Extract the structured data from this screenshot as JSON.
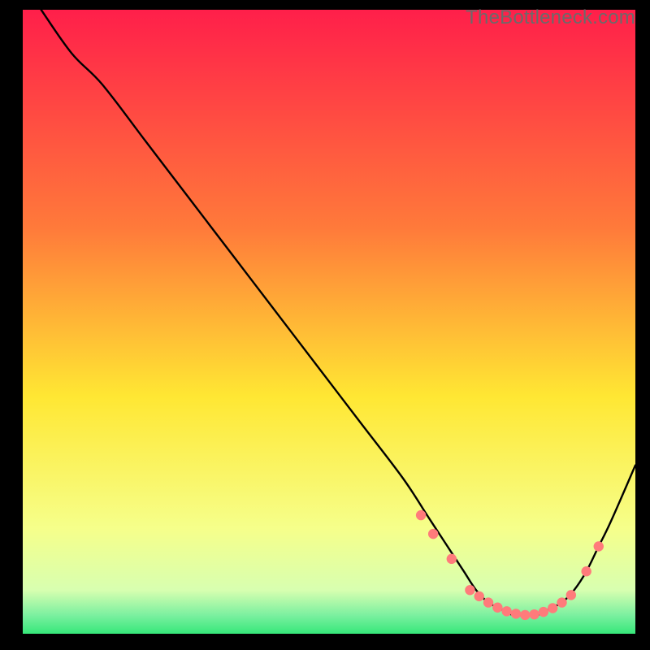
{
  "watermark": "TheBottleneck.com",
  "colors": {
    "gradient_top": "#ff1f4a",
    "gradient_mid1": "#ff7a3a",
    "gradient_mid2": "#ffe733",
    "gradient_mid3": "#f6ff8a",
    "gradient_green": "#36e77a",
    "curve": "#000000",
    "dot": "#ff7b7b",
    "watermark": "#6b6a6a"
  },
  "chart_data": {
    "type": "line",
    "title": "",
    "xlabel": "",
    "ylabel": "",
    "xlim": [
      0,
      100
    ],
    "ylim": [
      0,
      100
    ],
    "series": [
      {
        "name": "bottleneck-curve",
        "x": [
          3,
          8,
          13,
          20,
          27,
          34,
          41,
          48,
          55,
          62,
          66,
          68,
          70,
          72,
          74,
          76,
          78,
          80,
          82,
          84,
          86,
          88,
          90,
          92,
          94,
          96,
          100
        ],
        "y": [
          100,
          93,
          88,
          79,
          70,
          61,
          52,
          43,
          34,
          25,
          19,
          16,
          13,
          10,
          7,
          5,
          4,
          3,
          3,
          3,
          4,
          5,
          7,
          10,
          14,
          18,
          27
        ]
      }
    ],
    "markers": {
      "name": "highlight-dots",
      "x": [
        65,
        67,
        70,
        73,
        74.5,
        76,
        77.5,
        79,
        80.5,
        82,
        83.5,
        85,
        86.5,
        88,
        89.5,
        92,
        94
      ],
      "y": [
        19,
        16,
        12,
        7,
        6,
        5,
        4.2,
        3.6,
        3.2,
        3,
        3.1,
        3.5,
        4.1,
        5,
        6.2,
        10,
        14
      ]
    }
  }
}
